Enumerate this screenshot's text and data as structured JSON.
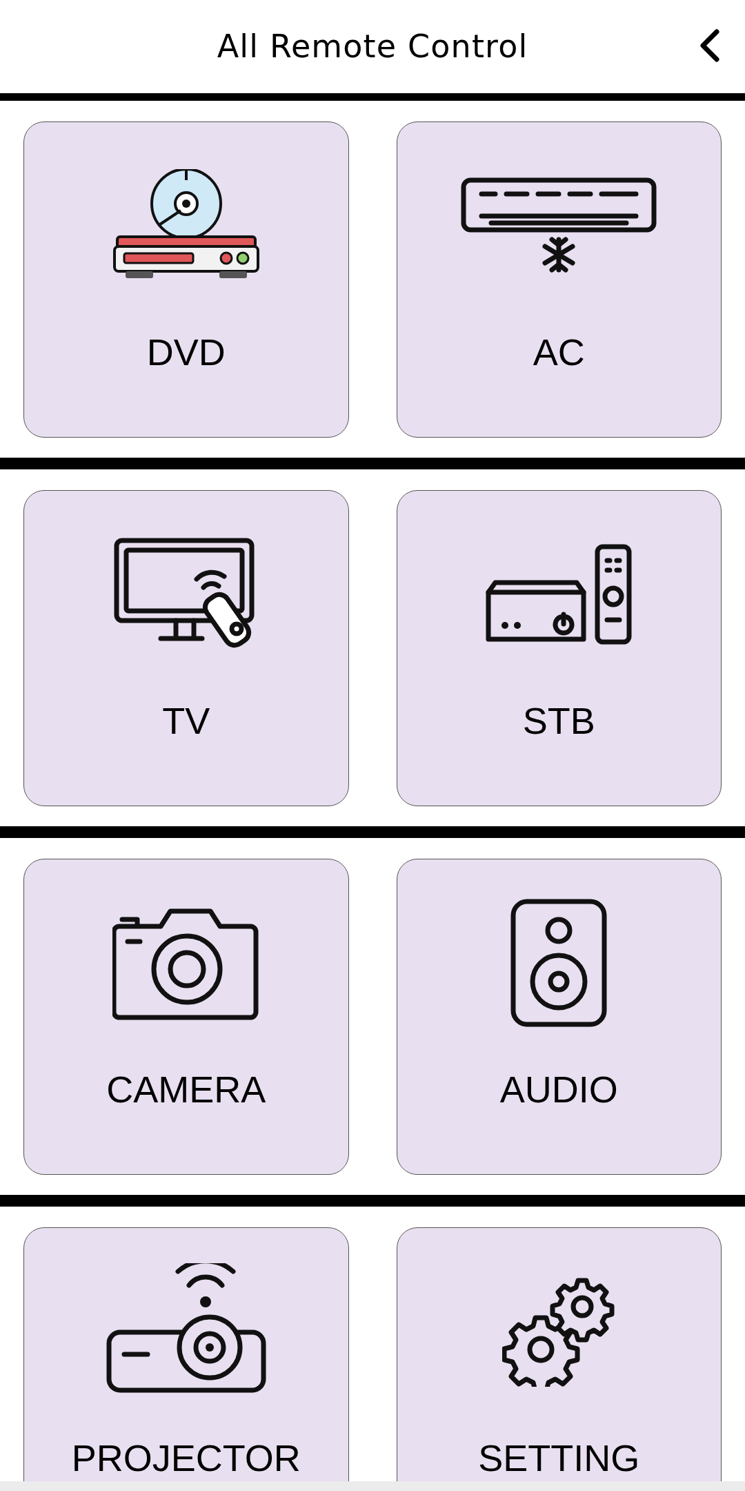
{
  "header": {
    "title": "All Remote Control"
  },
  "tiles": [
    {
      "kind": "dvd",
      "label": "DVD"
    },
    {
      "kind": "ac",
      "label": "AC"
    },
    {
      "kind": "tv",
      "label": "TV"
    },
    {
      "kind": "stb",
      "label": "STB"
    },
    {
      "kind": "camera",
      "label": "CAMERA"
    },
    {
      "kind": "audio",
      "label": "AUDIO"
    },
    {
      "kind": "projector",
      "label": "PROJECTOR"
    },
    {
      "kind": "setting",
      "label": "SETTING"
    }
  ]
}
